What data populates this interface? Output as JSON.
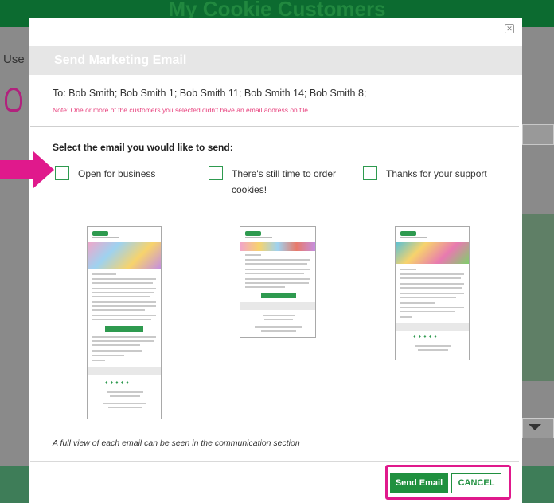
{
  "background": {
    "page_title": "My Cookie Customers",
    "left_fragment": "Use"
  },
  "modal": {
    "title": "Send Marketing Email",
    "to_line": "To: Bob Smith; Bob Smith 1; Bob Smith 11; Bob Smith 14; Bob Smith 8;",
    "note": "Note: One or more of the customers you selected didn't have an email address on file.",
    "section_label": "Select the email you would like to send:",
    "options": [
      {
        "label": "Open for business",
        "checked": false
      },
      {
        "label": "There's still time to order cookies!",
        "checked": false
      },
      {
        "label": "Thanks for your support",
        "checked": false
      }
    ],
    "footer_note": "A full view of each email can be seen in the communication section",
    "send_label": "Send Email",
    "cancel_label": "CANCEL"
  },
  "colors": {
    "brand_green": "#20903f",
    "highlight": "#e0198c",
    "note_pink": "#e8427e"
  },
  "icons": {
    "close": "close-icon",
    "arrow": "pointer-arrow-icon"
  }
}
